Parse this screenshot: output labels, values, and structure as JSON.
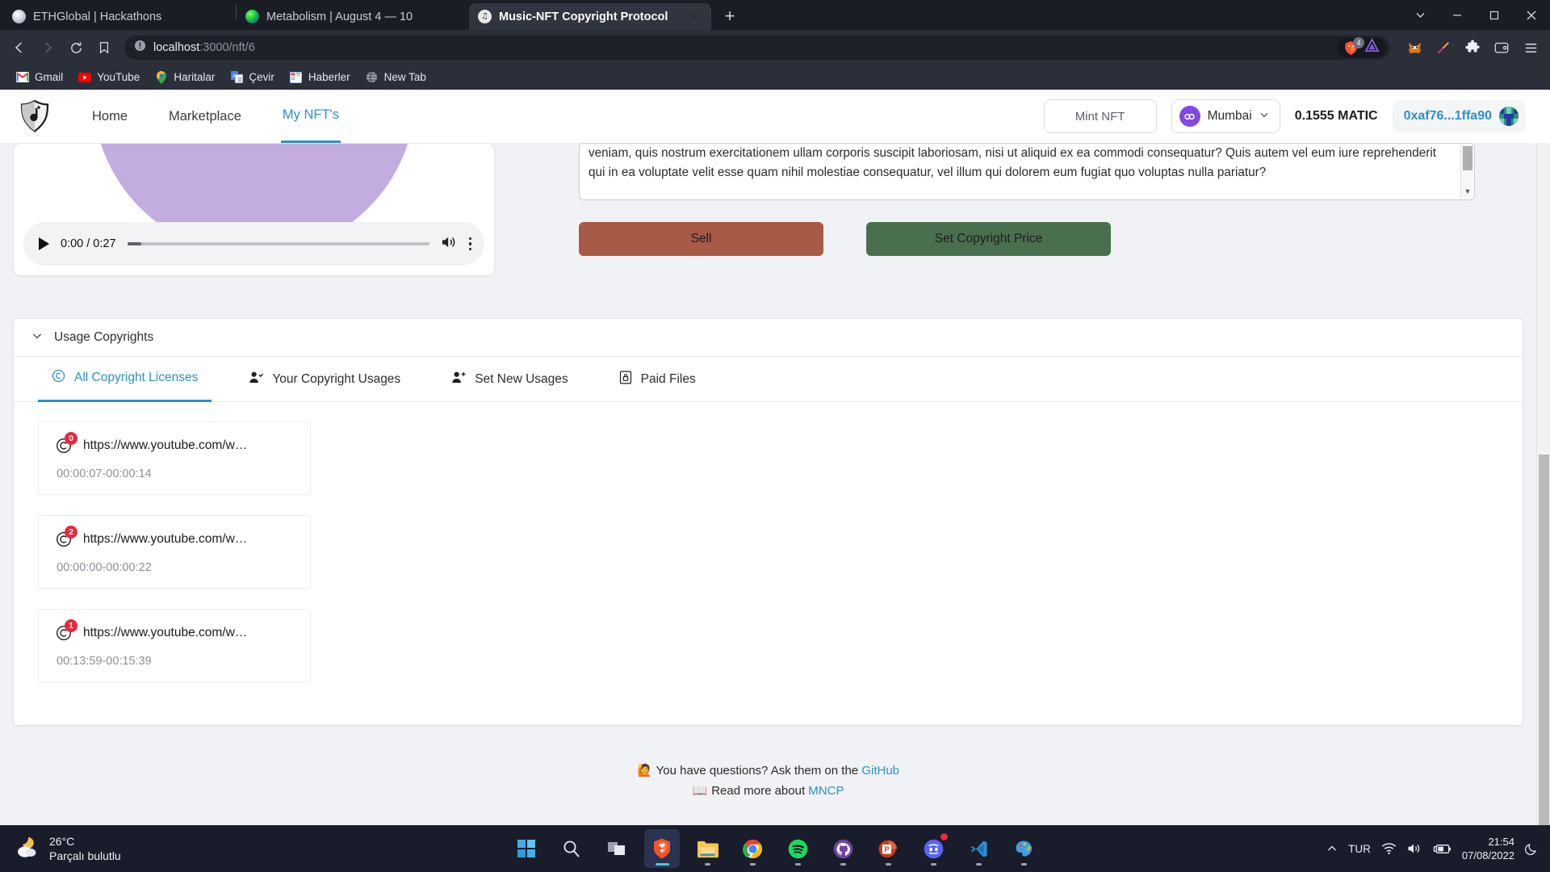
{
  "browser": {
    "tabs": [
      {
        "title": "ETHGlobal | Hackathons",
        "favicon": "ethglobal-icon",
        "active": false
      },
      {
        "title": "Metabolism | August 4 — 10",
        "favicon": "metabolism-icon",
        "active": false
      },
      {
        "title": "Music-NFT Copyright Protocol",
        "favicon": "mncp-icon",
        "active": true
      }
    ],
    "new_tab_label": "+",
    "window_controls": [
      "minimize-to-tray",
      "minimize",
      "maximize",
      "close"
    ],
    "url": {
      "host": "localhost",
      "path": ":3000/nft/6",
      "full": "localhost:3000/nft/6"
    },
    "shield_count": "4",
    "toolbar_icons": [
      "zoom-out-icon",
      "brave-shield-icon",
      "brave-rewards-icon",
      "metamask-icon",
      "color-picker-icon",
      "extensions-icon",
      "wallet-icon",
      "menu-icon"
    ],
    "bookmarks": [
      {
        "label": "Gmail",
        "icon": "gmail-icon"
      },
      {
        "label": "YouTube",
        "icon": "youtube-icon"
      },
      {
        "label": "Haritalar",
        "icon": "google-maps-icon"
      },
      {
        "label": "Çevir",
        "icon": "google-translate-icon"
      },
      {
        "label": "Haberler",
        "icon": "google-news-icon"
      },
      {
        "label": "New Tab",
        "icon": "globe-icon"
      }
    ]
  },
  "app": {
    "logo_name": "music-nft-shield-logo",
    "nav": [
      {
        "label": "Home",
        "active": false
      },
      {
        "label": "Marketplace",
        "active": false
      },
      {
        "label": "My NFT's",
        "active": true
      }
    ],
    "mint_label": "Mint NFT",
    "chain": {
      "label": "Mumbai",
      "icon": "polygon-icon",
      "chevron": "chevron-down-icon"
    },
    "balance": "0.1555 MATIC",
    "account": "0xaf76...1ffa90"
  },
  "media": {
    "current_time": "0:00",
    "duration": "0:27",
    "time_display": "0:00 / 0:27",
    "cover_color": "#c3ace0"
  },
  "description": {
    "text": "consectetur, adipisci velit, sed quia non numquam eius modi tempora incidunt ut labore et dolore magnam aliquam quaerat voluptatem. Ut enim ad minima veniam, quis nostrum exercitationem ullam corporis suscipit laboriosam, nisi ut aliquid ex ea commodi consequatur? Quis autem vel eum iure reprehenderit qui in ea voluptate velit esse quam nihil molestiae consequatur, vel illum qui dolorem eum fugiat quo voluptas nulla pariatur?"
  },
  "actions": {
    "sell_label": "Sell",
    "sell_color": "#a85a47",
    "copyright_label": "Set Copyright Price",
    "copyright_color": "#4a6f4e"
  },
  "usage_panel": {
    "title": "Usage Copyrights",
    "collapse_icon": "chevron-down-icon",
    "tabs": [
      {
        "label": "All Copyright Licenses",
        "icon": "copyright-icon",
        "active": true
      },
      {
        "label": "Your Copyright Usages",
        "icon": "person-check-icon",
        "active": false
      },
      {
        "label": "Set New Usages",
        "icon": "person-plus-icon",
        "active": false
      },
      {
        "label": "Paid Files",
        "icon": "locked-file-icon",
        "active": false
      }
    ],
    "licenses": [
      {
        "url": "https://www.youtube.com/w…",
        "range": "00:00:07-00:00:14",
        "badge": "0"
      },
      {
        "url": "https://www.youtube.com/w…",
        "range": "00:00:00-00:00:22",
        "badge": "2"
      },
      {
        "url": "https://www.youtube.com/w…",
        "range": "00:13:59-00:15:39",
        "badge": "1"
      }
    ]
  },
  "footer": {
    "line1_emoji": "🙋",
    "line1_text": "You have questions? Ask them on the ",
    "line1_link": "GitHub",
    "line2_emoji": "📖",
    "line2_text": "Read more about ",
    "line2_link": "MNCP"
  },
  "taskbar": {
    "weather": {
      "temp": "26°C",
      "condition": "Parçalı bulutlu",
      "icon": "moon-cloud-icon"
    },
    "apps": [
      {
        "name": "start-button",
        "icon": "windows-icon",
        "state": "idle"
      },
      {
        "name": "search-button",
        "icon": "search-icon",
        "state": "idle"
      },
      {
        "name": "task-view-button",
        "icon": "task-view-icon",
        "state": "idle"
      },
      {
        "name": "brave-browser",
        "icon": "brave-icon",
        "state": "active"
      },
      {
        "name": "file-explorer",
        "icon": "folder-icon",
        "state": "idle"
      },
      {
        "name": "google-chrome",
        "icon": "chrome-icon",
        "state": "running"
      },
      {
        "name": "spotify",
        "icon": "spotify-icon",
        "state": "running"
      },
      {
        "name": "github-desktop",
        "icon": "github-icon",
        "state": "running"
      },
      {
        "name": "powerpoint",
        "icon": "powerpoint-icon",
        "state": "running"
      },
      {
        "name": "discord",
        "icon": "discord-icon",
        "state": "running",
        "badge": true
      },
      {
        "name": "vs-code",
        "icon": "vscode-icon",
        "state": "running"
      },
      {
        "name": "paint",
        "icon": "paint-icon",
        "state": "running"
      }
    ],
    "tray": {
      "overflow": "chevron-up-icon",
      "language": "TUR",
      "icons": [
        "wifi-icon",
        "volume-icon",
        "battery-charging-icon"
      ],
      "time": "21:54",
      "date": "07/08/2022",
      "notifications": "moon-icon"
    }
  }
}
